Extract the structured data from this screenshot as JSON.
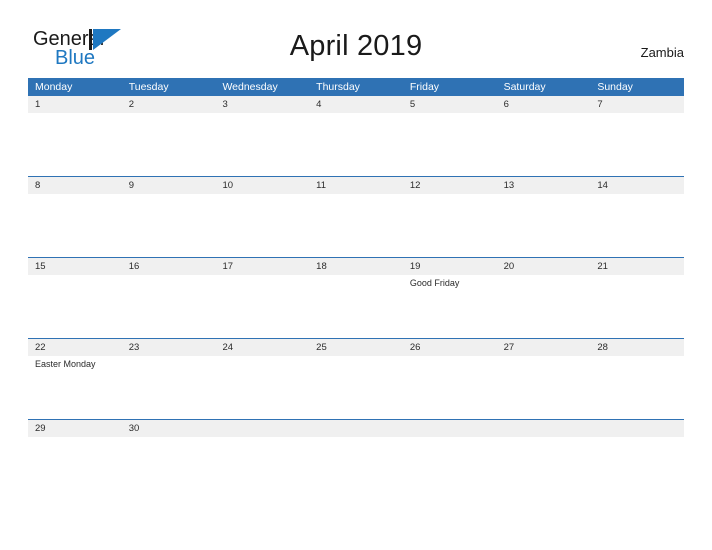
{
  "brand": {
    "name_part1": "General",
    "name_part2": "Blue",
    "mark": "triangle-logo-mark",
    "color_primary": "#1f78c1",
    "color_text": "#1a1a1a"
  },
  "header": {
    "title": "April 2019",
    "country": "Zambia"
  },
  "theme": {
    "header_blue": "#2f72b4",
    "rule_blue": "#2f72b4",
    "date_strip_gray": "#f0f0f0",
    "body_white": "#ffffff",
    "text_dark": "#2b2b2b"
  },
  "calendar": {
    "weekdays": [
      "Monday",
      "Tuesday",
      "Wednesday",
      "Thursday",
      "Friday",
      "Saturday",
      "Sunday"
    ],
    "weeks": [
      {
        "days": [
          {
            "date": "1",
            "events": []
          },
          {
            "date": "2",
            "events": []
          },
          {
            "date": "3",
            "events": []
          },
          {
            "date": "4",
            "events": []
          },
          {
            "date": "5",
            "events": []
          },
          {
            "date": "6",
            "events": []
          },
          {
            "date": "7",
            "events": []
          }
        ]
      },
      {
        "days": [
          {
            "date": "8",
            "events": []
          },
          {
            "date": "9",
            "events": []
          },
          {
            "date": "10",
            "events": []
          },
          {
            "date": "11",
            "events": []
          },
          {
            "date": "12",
            "events": []
          },
          {
            "date": "13",
            "events": []
          },
          {
            "date": "14",
            "events": []
          }
        ]
      },
      {
        "days": [
          {
            "date": "15",
            "events": []
          },
          {
            "date": "16",
            "events": []
          },
          {
            "date": "17",
            "events": []
          },
          {
            "date": "18",
            "events": []
          },
          {
            "date": "19",
            "events": [
              "Good Friday"
            ]
          },
          {
            "date": "20",
            "events": []
          },
          {
            "date": "21",
            "events": []
          }
        ]
      },
      {
        "days": [
          {
            "date": "22",
            "events": [
              "Easter Monday"
            ]
          },
          {
            "date": "23",
            "events": []
          },
          {
            "date": "24",
            "events": []
          },
          {
            "date": "25",
            "events": []
          },
          {
            "date": "26",
            "events": []
          },
          {
            "date": "27",
            "events": []
          },
          {
            "date": "28",
            "events": []
          }
        ]
      },
      {
        "days": [
          {
            "date": "29",
            "events": []
          },
          {
            "date": "30",
            "events": []
          },
          {
            "date": "",
            "events": []
          },
          {
            "date": "",
            "events": []
          },
          {
            "date": "",
            "events": []
          },
          {
            "date": "",
            "events": []
          },
          {
            "date": "",
            "events": []
          }
        ]
      }
    ]
  }
}
